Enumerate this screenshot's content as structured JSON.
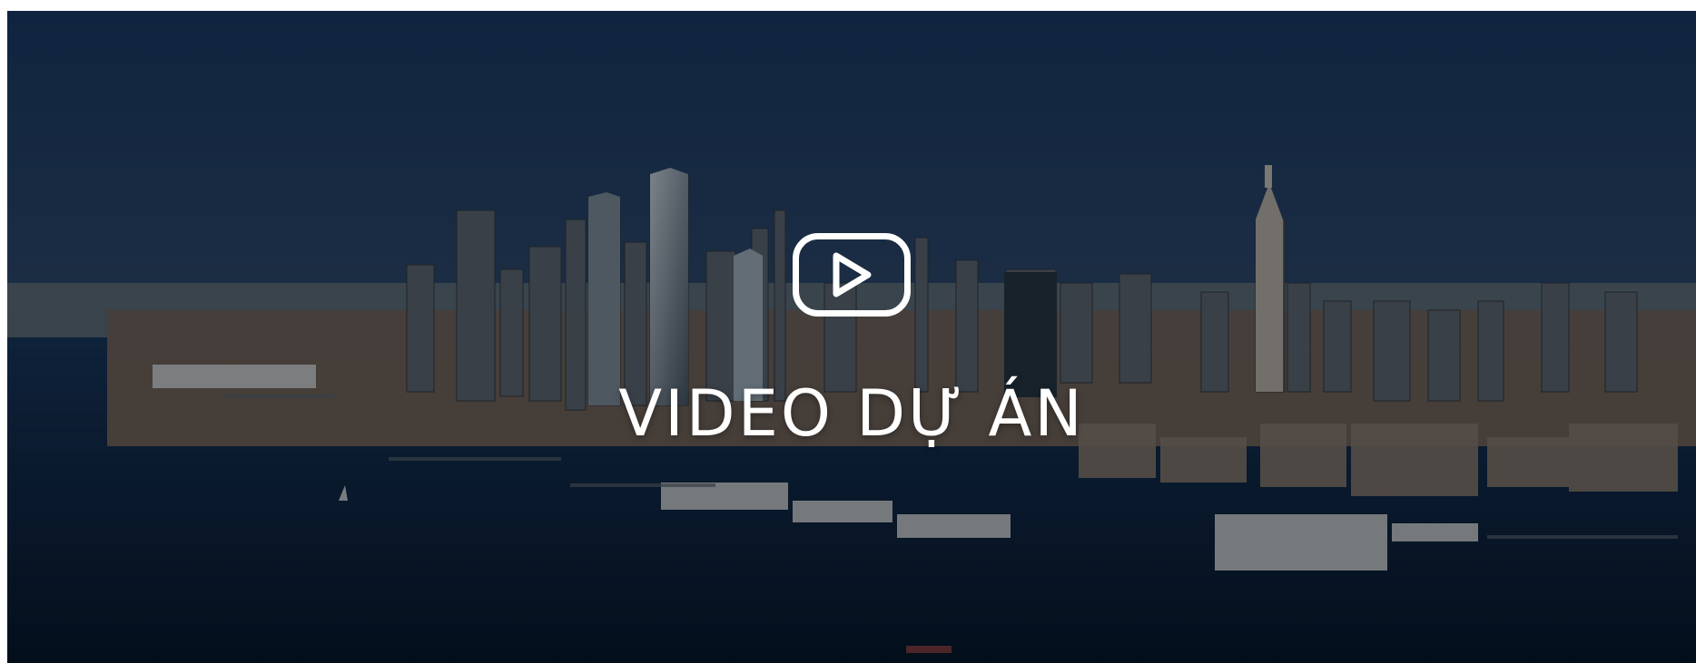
{
  "hero": {
    "title": "VIDEO DỰ ÁN",
    "play_icon": "play-icon",
    "scene": "city-skyline-waterfront"
  },
  "colors": {
    "overlay": "#000000",
    "title": "#ffffff",
    "sky_top": "#1b3b67",
    "sky_bottom": "#9aa7b4",
    "water": "#0b2340"
  }
}
